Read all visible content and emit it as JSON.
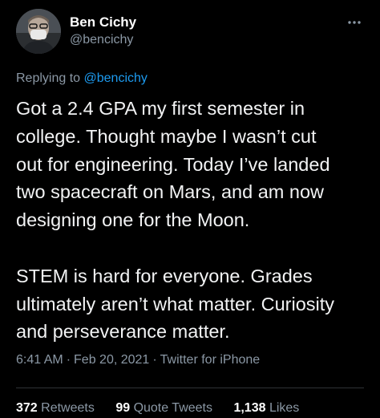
{
  "author": {
    "display_name": "Ben Cichy",
    "username": "@bencichy"
  },
  "reply": {
    "prefix": "Replying to ",
    "mention": "@bencichy"
  },
  "tweet": {
    "lines_p1": [
      "Got a 2.4 GPA my first semester in",
      "college. Thought maybe I wasn’t cut",
      "out for engineering. Today I’ve landed",
      "two spacecraft on Mars, and am now",
      "designing one for the Moon."
    ],
    "lines_p2": [
      "STEM is hard for everyone. Grades",
      "ultimately aren’t what matter.  Curiosity",
      "and perseverance matter."
    ]
  },
  "meta": {
    "time": "6:41 AM",
    "separator": "·",
    "date": "Feb 20, 2021",
    "source": "Twitter for iPhone"
  },
  "stats": {
    "retweets_count": "372",
    "retweets_label": "Retweets",
    "quotes_count": "99",
    "quotes_label": "Quote Tweets",
    "likes_count": "1,138",
    "likes_label": "Likes"
  },
  "colors": {
    "background": "#000000",
    "text_primary": "#e7e9ea",
    "text_secondary": "#8b98a5",
    "link_blue": "#1d9bf0",
    "divider": "#2f3336"
  },
  "icons": {
    "more": "more-horizontal-icon",
    "avatar": "profile-photo"
  }
}
